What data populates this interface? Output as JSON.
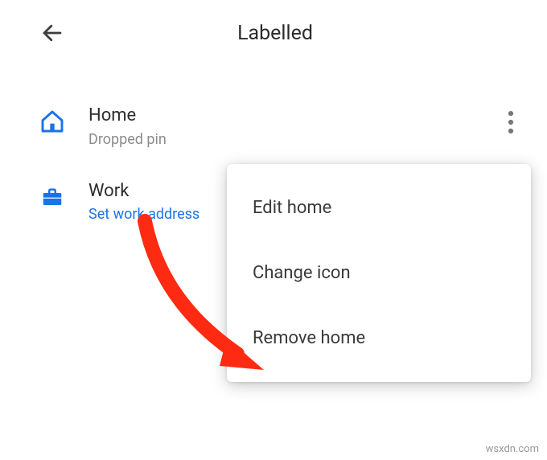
{
  "header": {
    "title": "Labelled"
  },
  "items": [
    {
      "title": "Home",
      "subtitle": "Dropped pin",
      "subtitle_link": false
    },
    {
      "title": "Work",
      "subtitle": "Set work address",
      "subtitle_link": true
    }
  ],
  "popup": {
    "options": [
      "Edit home",
      "Change icon",
      "Remove home"
    ]
  },
  "watermark": "wsxdn.com"
}
